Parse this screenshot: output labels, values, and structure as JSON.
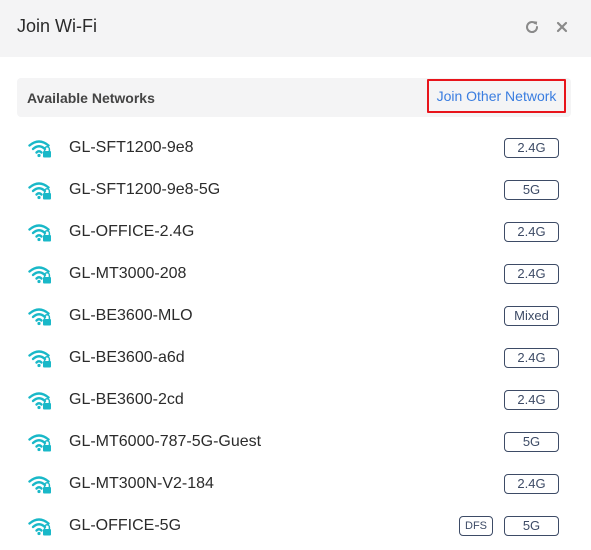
{
  "dialog": {
    "title": "Join Wi-Fi",
    "refresh_icon": "refresh-icon",
    "close_icon": "close-icon"
  },
  "section": {
    "title": "Available Networks",
    "join_other_label": "Join Other Network",
    "highlight_color": "#e8141b",
    "link_color": "#3a7de0"
  },
  "wifi_icon_color": "#19b8c8",
  "networks": [
    {
      "name": "GL-SFT1200-9e8",
      "band": "2.4G"
    },
    {
      "name": "GL-SFT1200-9e8-5G",
      "band": "5G"
    },
    {
      "name": "GL-OFFICE-2.4G",
      "band": "2.4G"
    },
    {
      "name": "GL-MT3000-208",
      "band": "2.4G"
    },
    {
      "name": "GL-BE3600-MLO",
      "band": "Mixed"
    },
    {
      "name": "GL-BE3600-a6d",
      "band": "2.4G"
    },
    {
      "name": "GL-BE3600-2cd",
      "band": "2.4G"
    },
    {
      "name": "GL-MT6000-787-5G-Guest",
      "band": "5G"
    },
    {
      "name": "GL-MT300N-V2-184",
      "band": "2.4G"
    },
    {
      "name": "GL-OFFICE-5G",
      "band": "5G",
      "dfs": "DFS"
    }
  ]
}
